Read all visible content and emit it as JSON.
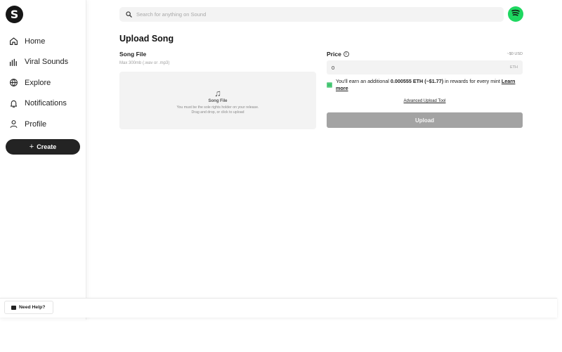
{
  "app": {
    "logo_letter": "S"
  },
  "sidebar": {
    "items": [
      {
        "label": "Home",
        "icon": "home-icon"
      },
      {
        "label": "Viral Sounds",
        "icon": "chart-bars-icon"
      },
      {
        "label": "Explore",
        "icon": "globe-icon"
      },
      {
        "label": "Notifications",
        "icon": "bell-icon"
      },
      {
        "label": "Profile",
        "icon": "user-icon"
      }
    ],
    "create_label": "Create"
  },
  "search": {
    "placeholder": "Search for anything on Sound"
  },
  "page": {
    "title": "Upload Song"
  },
  "song_file": {
    "label": "Song File",
    "hint": "Max 300mb (.wav or .mp3)",
    "dropzone_title": "Song File",
    "dropzone_line1": "You must be the sole rights holder on your release.",
    "dropzone_line2": "Drag and drop, or click to upload"
  },
  "price": {
    "label": "Price",
    "usd_approx": "~$0 USD",
    "value": "0",
    "unit": "ETH"
  },
  "rewards": {
    "prefix": "You'll earn an additional ",
    "amount": "0.000555 ETH (~$1.77)",
    "suffix": " in rewards for every mint ",
    "learn_more": "Learn more"
  },
  "advanced_link": "Advanced Upload Tool",
  "upload_label": "Upload",
  "help_label": "Need Help?",
  "colors": {
    "spotify_green": "#1ed760",
    "upload_disabled": "#a3a3a3",
    "primary_dark": "#232323"
  }
}
